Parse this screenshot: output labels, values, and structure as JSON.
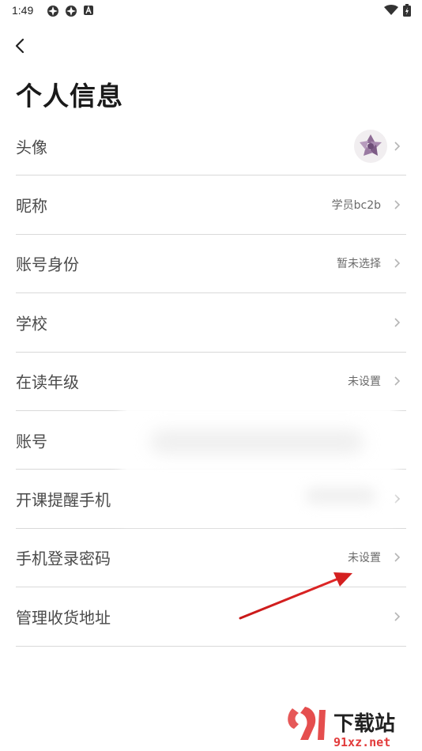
{
  "status_bar": {
    "time": "1:49"
  },
  "header": {
    "back_icon": "chevron-left-icon",
    "title": "个人信息"
  },
  "rows": [
    {
      "label": "头像",
      "value": ""
    },
    {
      "label": "昵称",
      "value": "学员bc2b"
    },
    {
      "label": "账号身份",
      "value": "暂未选择"
    },
    {
      "label": "学校",
      "value": ""
    },
    {
      "label": "在读年级",
      "value": "未设置"
    },
    {
      "label": "账号",
      "value": ""
    },
    {
      "label": "开课提醒手机",
      "value": ""
    },
    {
      "label": "手机登录密码",
      "value": "未设置"
    },
    {
      "label": "管理收货地址",
      "value": ""
    }
  ],
  "watermark": {
    "brand": "下载站",
    "domain": "91xz.net"
  },
  "colors": {
    "title": "#1a1a1a",
    "label": "#4a4a4a",
    "value": "#6a6a6a",
    "divider": "#d9d9d9",
    "annotation_arrow": "#d42020"
  }
}
